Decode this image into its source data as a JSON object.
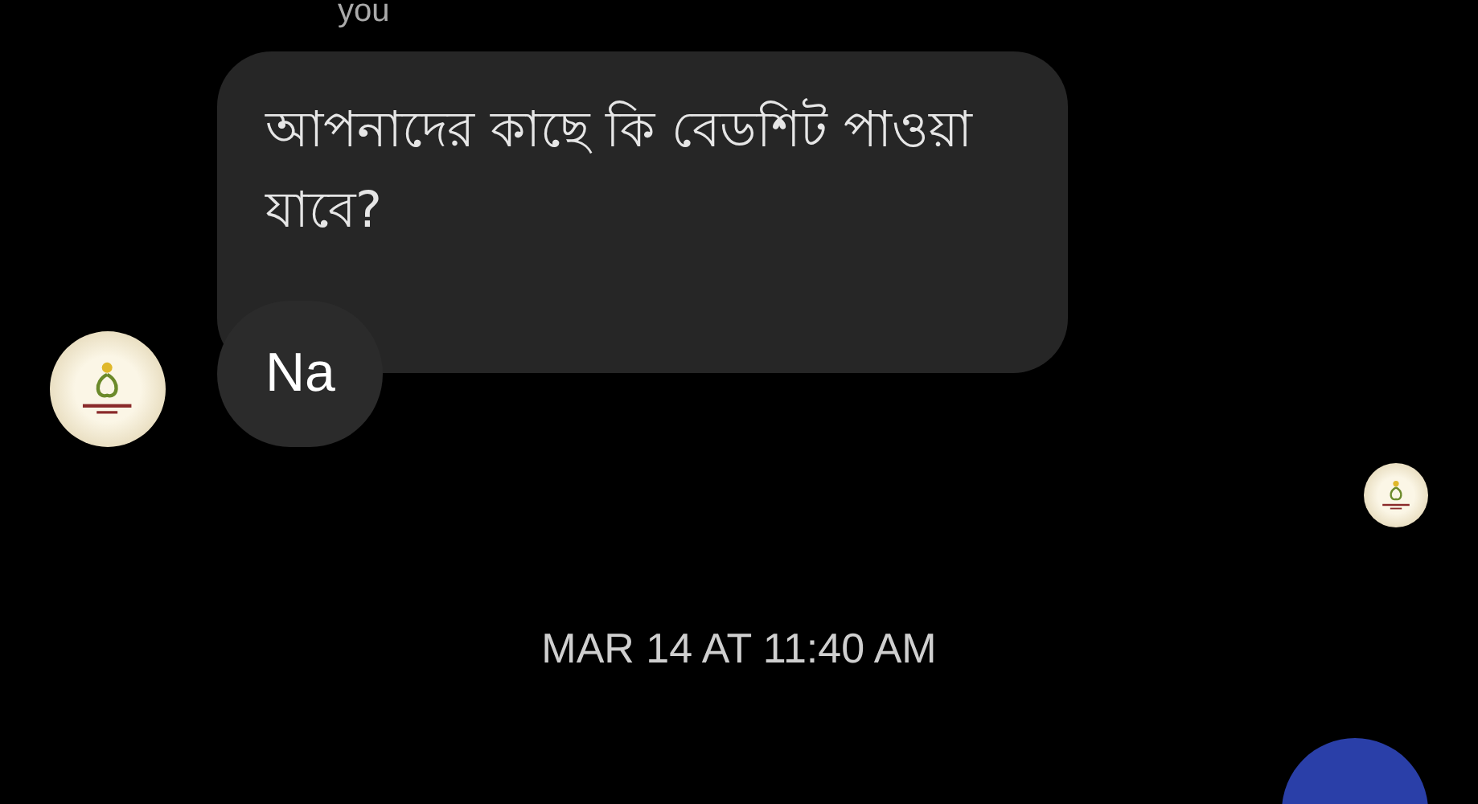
{
  "sender_label": "you",
  "messages": [
    {
      "kind": "text",
      "text": "আপনাদের কাছে কি বেডশিট পাওয়া যাবে?"
    },
    {
      "kind": "text",
      "text": "Na"
    }
  ],
  "timestamp": "MAR 14 AT 11:40 AM"
}
